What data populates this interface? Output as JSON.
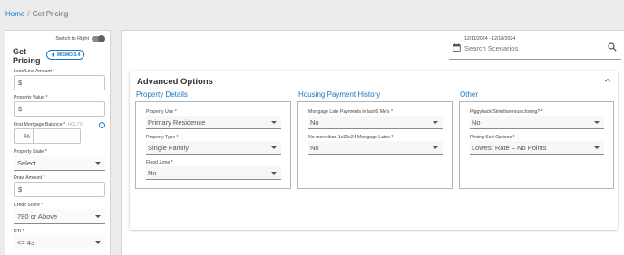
{
  "breadcrumb": {
    "home": "Home",
    "separator": "/",
    "current": "Get Pricing"
  },
  "left": {
    "switch_label": "Switch to Right",
    "title": "Get Pricing",
    "mismo_badge": "MISMO 3.4",
    "fields": {
      "loan_amount": {
        "label": "Loan/Line Amount *",
        "value": "$"
      },
      "property_value": {
        "label": "Property Value *",
        "value": "$"
      },
      "first_mortgage": {
        "label": "First Mortgage Balance *",
        "hcltv": "HCLTV",
        "value": "$",
        "pct": "%"
      },
      "property_state": {
        "label": "Property State *",
        "value": "Select"
      },
      "draw_amount": {
        "label": "Draw Amount *",
        "value": "$"
      },
      "credit_score": {
        "label": "Credit Score *",
        "value": "780 or Above"
      },
      "dti": {
        "label": "DTI *",
        "value": "<= 43"
      }
    }
  },
  "search": {
    "date_range": "12/11/2024 - 12/18/2024",
    "placeholder": "Search Scenarios"
  },
  "advanced": {
    "title": "Advanced Options",
    "columns": {
      "property": {
        "title": "Property Details",
        "use": {
          "label": "Property Use *",
          "value": "Primary Residence"
        },
        "type": {
          "label": "Property Type *",
          "value": "Single Family"
        },
        "flood": {
          "label": "Flood Zone *",
          "value": "No"
        }
      },
      "housing": {
        "title": "Housing Payment History",
        "late": {
          "label": "Mortgage Late Payments in last 6 Mo's *",
          "value": "No"
        },
        "lates": {
          "label": "No more than 1x30x24 Mortgage Lates *",
          "value": "No"
        }
      },
      "other": {
        "title": "Other",
        "piggyback": {
          "label": "Piggyback/Simultaneous closing? *",
          "value": "No"
        },
        "sort": {
          "label": "Pricing Sort Options *",
          "value": "Lowest Rate – No Points"
        }
      }
    }
  }
}
